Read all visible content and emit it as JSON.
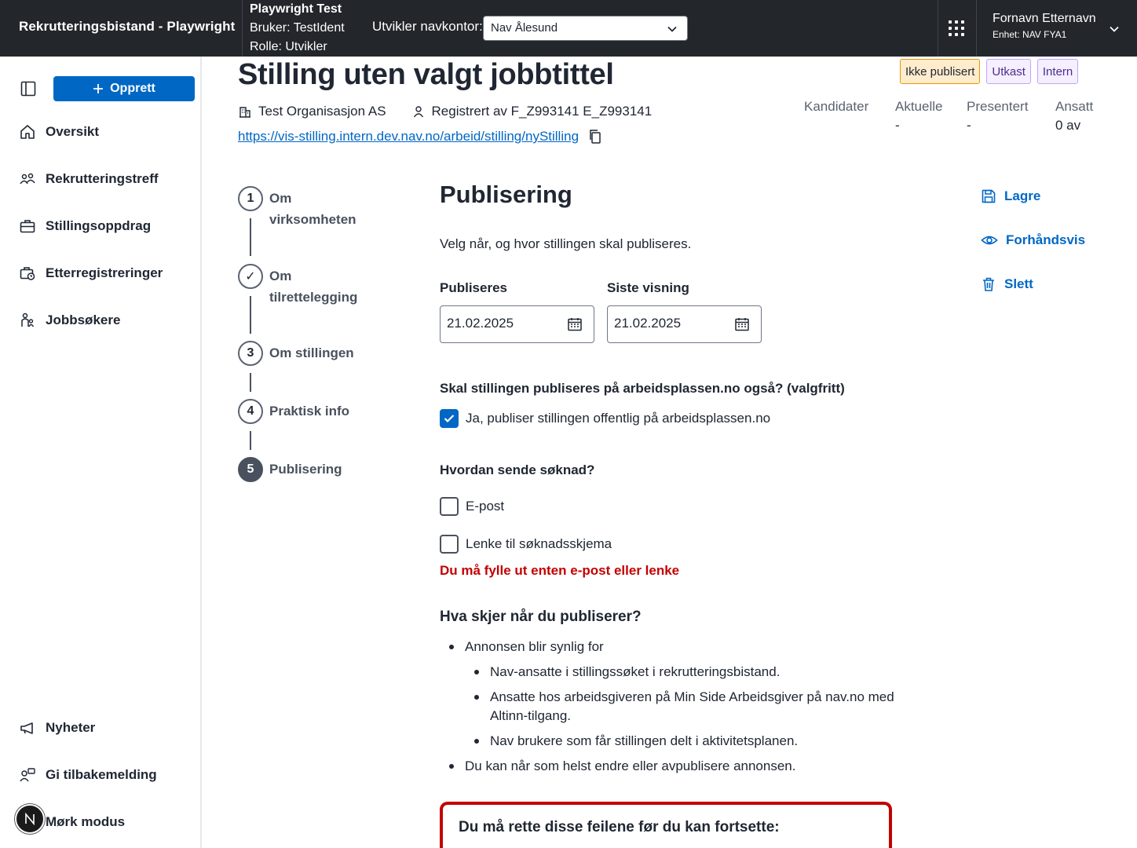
{
  "topbar": {
    "app_title": "Rekrutteringsbistand - Playwright",
    "dev_title": "Playwright Test",
    "dev_user": "Bruker: TestIdent",
    "dev_role": "Rolle: Utvikler",
    "kontor_label": "Utvikler navkontor:",
    "kontor_value": "Nav Ålesund",
    "user_name": "Fornavn Etternavn",
    "user_unit": "Enhet: NAV FYA1"
  },
  "sidebar": {
    "create_label": "Opprett",
    "items": [
      {
        "label": "Oversikt",
        "icon": "house-icon"
      },
      {
        "label": "Rekrutteringstreff",
        "icon": "people-icon"
      },
      {
        "label": "Stillingsoppdrag",
        "icon": "briefcase-icon"
      },
      {
        "label": "Etterregistreringer",
        "icon": "briefcase-clock-icon"
      },
      {
        "label": "Jobbsøkere",
        "icon": "person-group-icon"
      }
    ],
    "bottom_items": [
      {
        "label": "Nyheter",
        "icon": "megaphone-icon"
      },
      {
        "label": "Gi tilbakemelding",
        "icon": "feedback-icon"
      },
      {
        "label": "Mørk modus",
        "icon": "moon-icon"
      }
    ]
  },
  "header": {
    "title": "Stilling uten valgt jobbtittel",
    "tags": [
      "Ikke publisert",
      "Utkast",
      "Intern"
    ],
    "organisation": "Test Organisasjon AS",
    "registered_by": "Registrert av F_Z993141 E_Z993141",
    "link": "https://vis-stilling.intern.dev.nav.no/arbeid/stilling/nyStilling",
    "stats": [
      {
        "label": "Kandidater",
        "value": ""
      },
      {
        "label": "Aktuelle",
        "value": "-"
      },
      {
        "label": "Presentert",
        "value": "-"
      },
      {
        "label": "Ansatt",
        "value": "0 av"
      }
    ]
  },
  "stepper": {
    "steps": [
      {
        "number": "1",
        "label": "Om virksomheten",
        "state": "default"
      },
      {
        "number": "✓",
        "label": "Om tilrettelegging",
        "state": "completed"
      },
      {
        "number": "3",
        "label": "Om stillingen",
        "state": "default"
      },
      {
        "number": "4",
        "label": "Praktisk info",
        "state": "default"
      },
      {
        "number": "5",
        "label": "Publisering",
        "state": "active"
      }
    ]
  },
  "form": {
    "title": "Publisering",
    "intro": "Velg når, og hvor stillingen skal publiseres.",
    "publish_label": "Publiseres",
    "publish_value": "21.02.2025",
    "last_label": "Siste visning",
    "last_value": "21.02.2025",
    "public_question": "Skal stillingen publiseres på arbeidsplassen.no også? (valgfritt)",
    "public_option": "Ja, publiser stillingen offentlig på arbeidsplassen.no",
    "public_checked": true,
    "apply_question": "Hvordan sende søknad?",
    "apply_email": "E-post",
    "apply_link": "Lenke til søknadsskjema",
    "apply_error": "Du må fylle ut enten e-post eller lenke",
    "info_title": "Hva skjer når du publiserer?",
    "info_items": [
      "Annonsen blir synlig for",
      "Nav-ansatte i stillingssøket i rekrutteringsbistand.",
      "Ansatte hos arbeidsgiveren på Min Side Arbeidsgiver på nav.no med Altinn-tilgang.",
      "Nav brukere som får stillingen delt i aktivitetsplanen.",
      "Du kan når som helst endre eller avpublisere annonsen."
    ],
    "error_summary_title": "Du må rette disse feilene før du kan fortsette:"
  },
  "actions": {
    "save": "Lagre",
    "preview": "Forhåndsvis",
    "delete": "Slett"
  },
  "colors": {
    "accent": "#0067c5",
    "topbar": "#23262a",
    "error": "#c30000"
  }
}
